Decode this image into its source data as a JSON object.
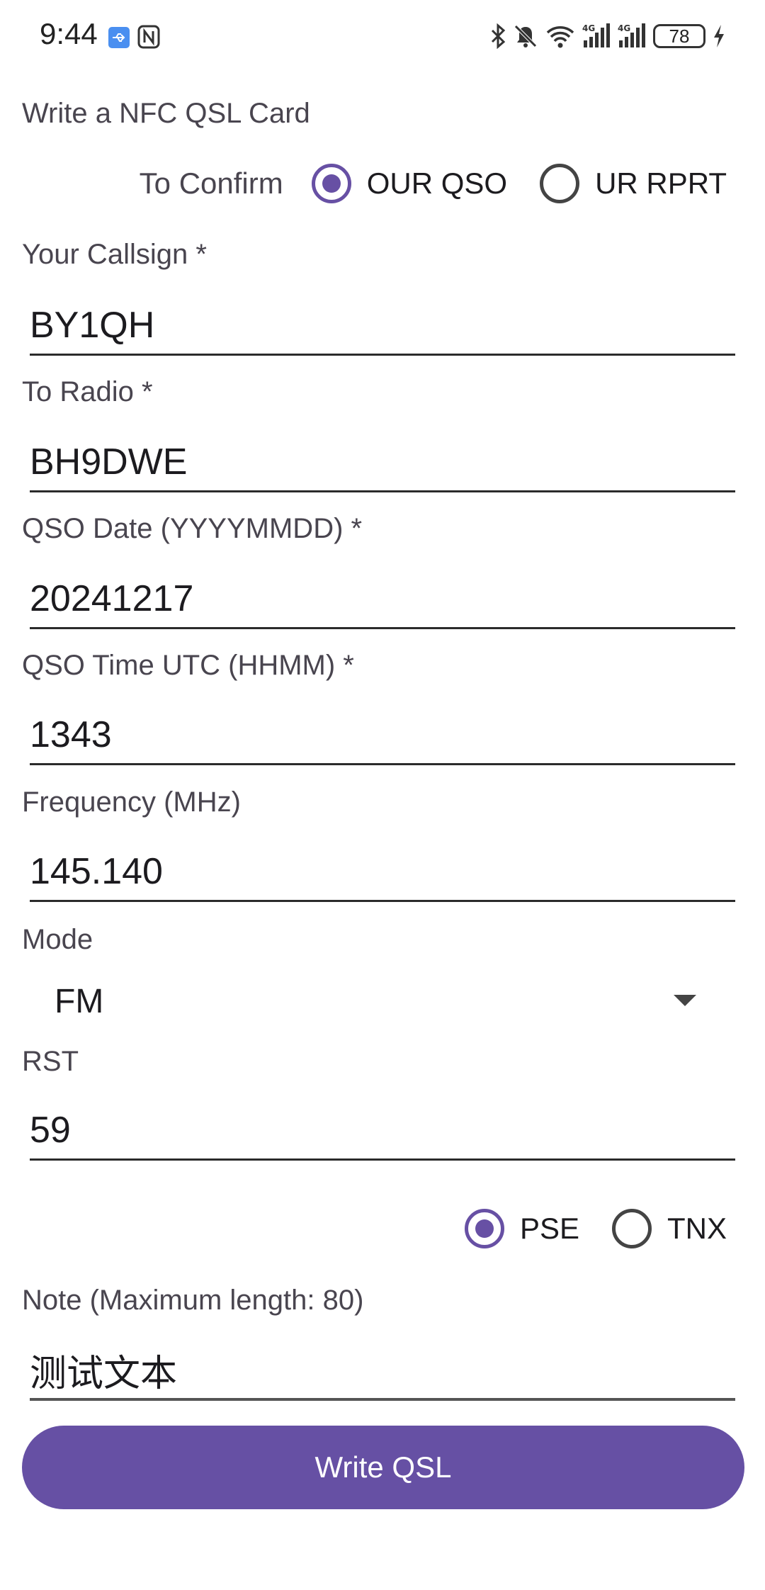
{
  "status_bar": {
    "time": "9:44",
    "battery": "78",
    "icons": [
      "usb-icon",
      "nfc-icon",
      "bluetooth-icon",
      "mute-icon",
      "wifi-icon",
      "signal-4g-icon",
      "signal-4g-icon",
      "battery-icon",
      "charging-icon"
    ]
  },
  "page": {
    "title": "Write a NFC QSL Card"
  },
  "confirm": {
    "label": "To Confirm",
    "options": [
      {
        "label": "OUR QSO",
        "checked": true
      },
      {
        "label": "UR RPRT",
        "checked": false
      }
    ]
  },
  "fields": {
    "callsign": {
      "label": "Your Callsign *",
      "value": "BY1QH"
    },
    "to_radio": {
      "label": "To Radio *",
      "value": "BH9DWE"
    },
    "qso_date": {
      "label": "QSO Date (YYYYMMDD) *",
      "value": "20241217"
    },
    "qso_time": {
      "label": "QSO Time UTC (HHMM) *",
      "value": "1343"
    },
    "frequency": {
      "label": "Frequency (MHz)",
      "value": "145.140"
    },
    "mode": {
      "label": "Mode",
      "value": "FM"
    },
    "rst": {
      "label": "RST",
      "value": "59"
    },
    "note": {
      "label": "Note (Maximum length: 80)",
      "value": "测试文本"
    }
  },
  "qsl": {
    "options": [
      {
        "label": "PSE",
        "checked": true
      },
      {
        "label": "TNX",
        "checked": false
      }
    ]
  },
  "button": {
    "label": "Write QSL"
  },
  "colors": {
    "accent": "#6750a4",
    "button": "#6650a4"
  }
}
